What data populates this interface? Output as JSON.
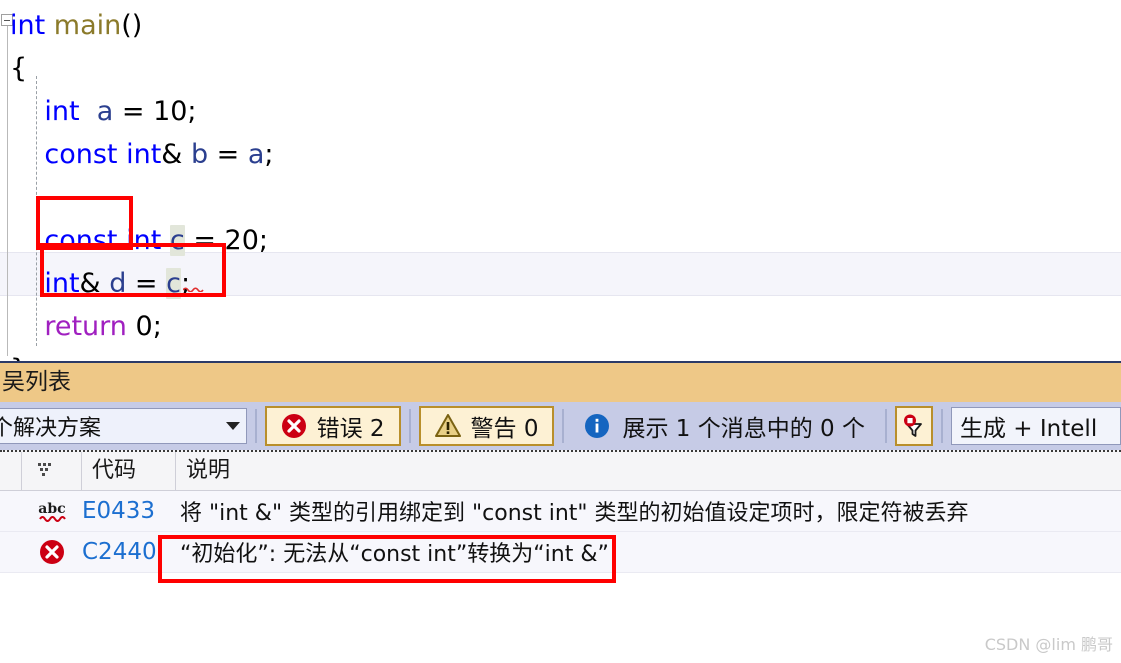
{
  "editor": {
    "lines": [
      {
        "tokens": [
          {
            "t": "int",
            "c": "kw"
          },
          {
            "t": " ",
            "c": "pun"
          },
          {
            "t": "main",
            "c": "fn"
          },
          {
            "t": "()",
            "c": "pun"
          }
        ]
      },
      {
        "tokens": [
          {
            "t": "{",
            "c": "pun"
          }
        ]
      },
      {
        "tokens": [
          {
            "t": "    ",
            "c": "pun"
          },
          {
            "t": "int",
            "c": "kw"
          },
          {
            "t": "  ",
            "c": "pun"
          },
          {
            "t": "a",
            "c": "var"
          },
          {
            "t": " = ",
            "c": "pun"
          },
          {
            "t": "10",
            "c": "num"
          },
          {
            "t": ";",
            "c": "pun"
          }
        ]
      },
      {
        "tokens": [
          {
            "t": "    ",
            "c": "pun"
          },
          {
            "t": "const",
            "c": "kw"
          },
          {
            "t": " ",
            "c": "pun"
          },
          {
            "t": "int",
            "c": "kw"
          },
          {
            "t": "&",
            "c": "pun"
          },
          {
            "t": " ",
            "c": "pun"
          },
          {
            "t": "b",
            "c": "var"
          },
          {
            "t": " = ",
            "c": "pun"
          },
          {
            "t": "a",
            "c": "var"
          },
          {
            "t": ";",
            "c": "pun"
          }
        ]
      },
      {
        "tokens": []
      },
      {
        "tokens": [
          {
            "t": "    ",
            "c": "pun"
          },
          {
            "t": "const",
            "c": "kw"
          },
          {
            "t": " ",
            "c": "pun"
          },
          {
            "t": "int",
            "c": "kw"
          },
          {
            "t": " ",
            "c": "pun"
          },
          {
            "t": "c",
            "c": "var hl-ref"
          },
          {
            "t": " = ",
            "c": "pun"
          },
          {
            "t": "20",
            "c": "num"
          },
          {
            "t": ";",
            "c": "pun"
          }
        ]
      },
      {
        "tokens": [
          {
            "t": "    ",
            "c": "pun"
          },
          {
            "t": "int",
            "c": "kw"
          },
          {
            "t": "&",
            "c": "pun"
          },
          {
            "t": " ",
            "c": "pun"
          },
          {
            "t": "d",
            "c": "var"
          },
          {
            "t": " = ",
            "c": "pun"
          },
          {
            "t": "c",
            "c": "var hl-ref"
          },
          {
            "t": ";",
            "c": "pun"
          }
        ]
      },
      {
        "tokens": [
          {
            "t": "    ",
            "c": "pun"
          },
          {
            "t": "return",
            "c": "ctrl"
          },
          {
            "t": " ",
            "c": "pun"
          },
          {
            "t": "0",
            "c": "num"
          },
          {
            "t": ";",
            "c": "pun"
          }
        ]
      },
      {
        "tokens": [
          {
            "t": "}",
            "c": "pun"
          }
        ]
      }
    ]
  },
  "panel": {
    "tab_label": "吴列表",
    "toolbar": {
      "scope_value": "个解决方案",
      "errors_label": "错误 2",
      "warnings_label": "警告 0",
      "messages_label": "展示 1 个消息中的 0 个",
      "filter_icon": "filter-funnel-icon",
      "build_value": "生成 + Intell"
    },
    "table": {
      "columns": [
        "代码",
        "说明"
      ],
      "rows": [
        {
          "icon": "intellisense-abc-icon",
          "code": "E0433",
          "description": "将 \"int &\" 类型的引用绑定到 \"const int\" 类型的初始值设定项时，限定符被丢弃"
        },
        {
          "icon": "error-circle-x-icon",
          "code": "C2440",
          "description": "“初始化”: 无法从“const int”转换为“int &”"
        }
      ]
    }
  },
  "watermark": "CSDN @lim 鹏哥",
  "colors": {
    "keyword": "#0000ff",
    "function": "#8b7a2a",
    "variable": "#2b3f8f",
    "control": "#a020c0",
    "annotation": "#ff0000",
    "tab_bg": "#eec887",
    "toolbar_bg": "#c6cbe6",
    "error_red": "#cc0000",
    "code_link": "#1c6fd0"
  }
}
